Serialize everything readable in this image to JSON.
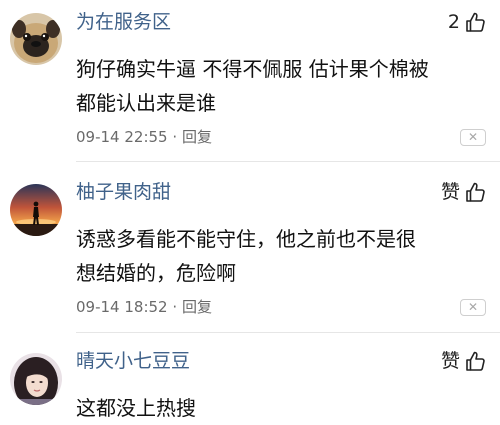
{
  "comments": [
    {
      "username": "为在服务区",
      "like_label": "2",
      "avatar_icon": "pug-dog-avatar",
      "text_lines": [
        "狗仔确实牛逼 不得不佩服 估计果个棉被",
        "都能认出来是谁"
      ],
      "date": "09-14 22:55",
      "separator": "·",
      "reply_label": "回复"
    },
    {
      "username": "柚子果肉甜",
      "like_label": "赞",
      "avatar_icon": "sunset-silhouette-avatar",
      "text_lines": [
        "诱惑多看能不能守住，他之前也不是很",
        "想结婚的，危险啊"
      ],
      "date": "09-14 18:52",
      "separator": "·",
      "reply_label": "回复"
    },
    {
      "username": "晴天小七豆豆",
      "like_label": "赞",
      "avatar_icon": "girl-portrait-avatar",
      "text_lines": [
        "这都没上热搜"
      ]
    }
  ],
  "colors": {
    "username": "#40628a",
    "body": "#111111",
    "meta": "#6a6a6a"
  }
}
